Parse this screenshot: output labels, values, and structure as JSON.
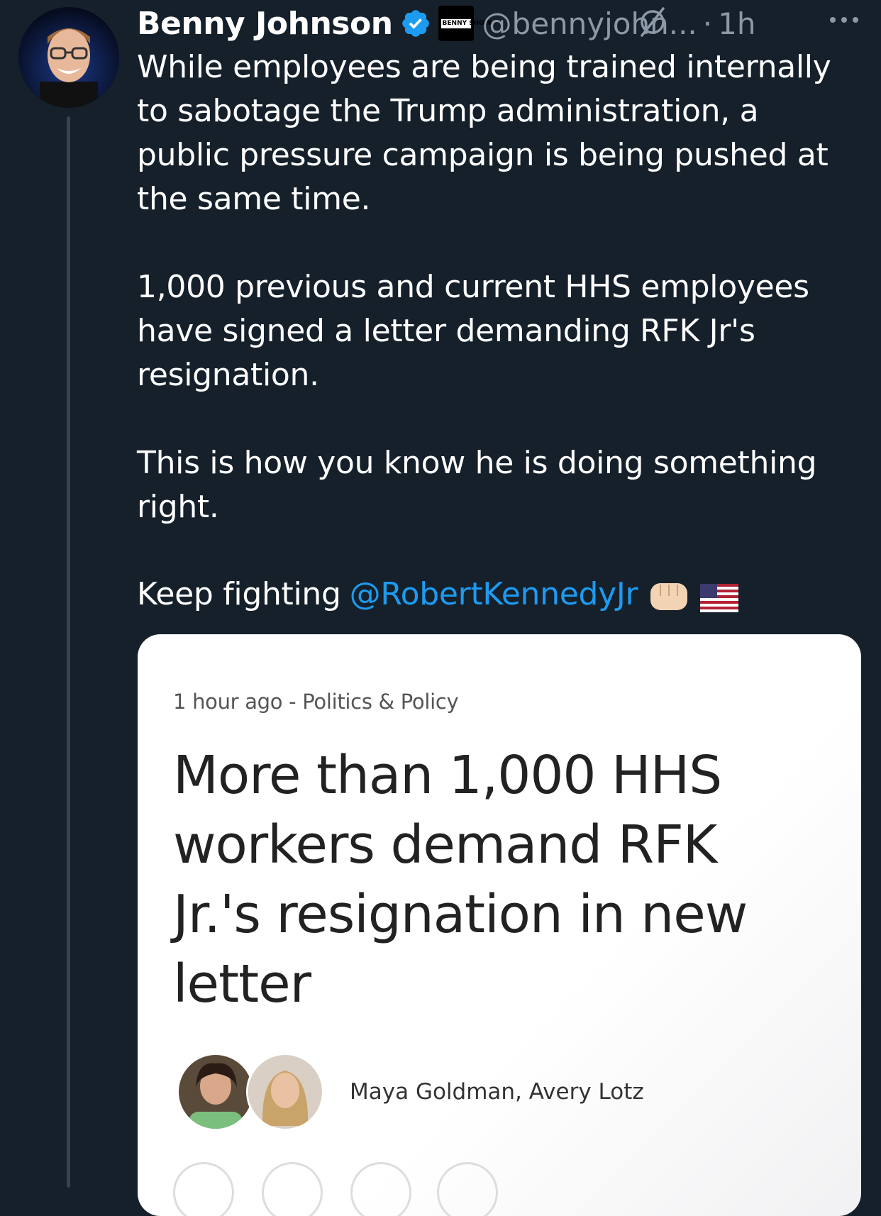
{
  "tweet": {
    "display_name": "Benny Johnson",
    "handle": "@bennyjohn...",
    "separator": "·",
    "time": "1h",
    "affiliate_badge_text": "BENNY SHOW",
    "paragraph_1": "While employees are being trained internally\nto sabotage the Trump administration, a\npublic pressure campaign is being pushed at\nthe same time.",
    "paragraph_2": "1,000 previous and current HHS employees\nhave signed a letter demanding RFK Jr's\nresignation.",
    "paragraph_3": "This is how you know he is doing something\nright.",
    "paragraph_4_prefix": "Keep fighting",
    "mention": "@RobertKennedyJr"
  },
  "card": {
    "meta": "1 hour ago - Politics & Policy",
    "headline": "More than 1,000 HHS\nworkers demand RFK\nJr.'s resignation in new\nletter",
    "authors": "Maya Goldman, Avery Lotz"
  },
  "colors": {
    "background": "#15202b",
    "text": "#ffffff",
    "secondary": "#8b98a5",
    "link": "#1d9bf0",
    "verified": "#1d9bf0"
  }
}
